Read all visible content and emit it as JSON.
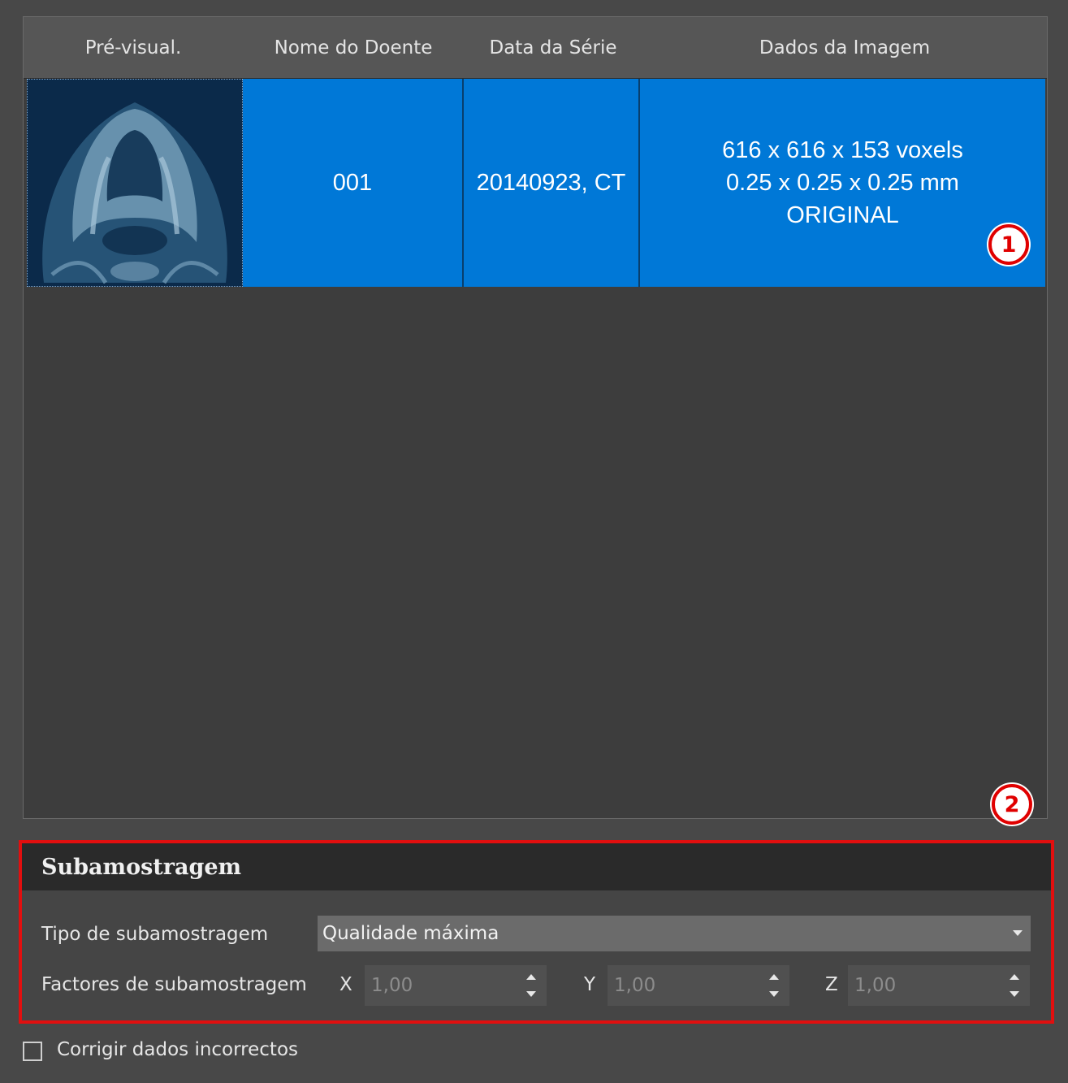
{
  "table": {
    "headers": [
      "Pré-visual.",
      "Nome do Doente",
      "Data da Série",
      "Dados da Imagem"
    ],
    "rows": [
      {
        "preview_icon": "ct-dental-scan-thumbnail",
        "patient_name": "001",
        "series_date": "20140923, CT",
        "image_data": [
          "616 x 616 x 153 voxels",
          "0.25 x 0.25 x 0.25 mm",
          "ORIGINAL"
        ]
      }
    ]
  },
  "callouts": [
    "1",
    "2"
  ],
  "subsampling": {
    "title": "Subamostragem",
    "type_label": "Tipo de subamostragem",
    "type_value": "Qualidade máxima",
    "factors_label": "Factores de subamostragem",
    "factors": [
      {
        "axis": "X",
        "value": "1,00"
      },
      {
        "axis": "Y",
        "value": "1,00"
      },
      {
        "axis": "Z",
        "value": "1,00"
      }
    ]
  },
  "fix_data": {
    "label": "Corrigir dados incorrectos",
    "checked": false
  },
  "colors": {
    "selection": "#0078d7",
    "callout_red": "#e00000",
    "background": "#484848"
  }
}
